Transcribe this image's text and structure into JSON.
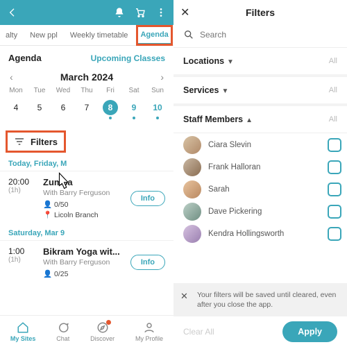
{
  "left": {
    "tabs": {
      "t0": "alty",
      "t1": "New ppl",
      "t2": "Weekly timetable",
      "t3": "Agenda"
    },
    "section": {
      "title": "Agenda",
      "upcoming": "Upcoming Classes"
    },
    "month": "March 2024",
    "dow": {
      "d0": "Mon",
      "d1": "Tue",
      "d2": "Wed",
      "d3": "Thu",
      "d4": "Fri",
      "d5": "Sat",
      "d6": "Sun"
    },
    "dates": {
      "n0": "4",
      "n1": "5",
      "n2": "6",
      "n3": "7",
      "n4": "8",
      "n5": "9",
      "n6": "10"
    },
    "filters_label": "Filters",
    "today_label": "Today, Friday, M",
    "sat_label": "Saturday, Mar 9",
    "class1": {
      "time": "20:00",
      "dur": "(1h)",
      "name": "Zumba",
      "with": "With Barry Ferguson",
      "cap": "0/50",
      "loc": "Licoln Branch",
      "info": "Info"
    },
    "class2": {
      "time": "1:00",
      "dur": "(1h)",
      "name": "Bikram Yoga wit...",
      "with": "With Barry Ferguson",
      "cap": "0/25",
      "info": "Info"
    },
    "nav": {
      "a": "My Sites",
      "b": "Chat",
      "c": "Discover",
      "d": "My Profile"
    }
  },
  "right": {
    "title": "Filters",
    "search_ph": "Search",
    "loc": "Locations",
    "svc": "Services",
    "staff": "Staff Members",
    "all": "All",
    "s0": "Ciara Slevin",
    "s1": "Frank Halloran",
    "s2": "Sarah",
    "s3": "Dave Pickering",
    "s4": "Kendra Hollingsworth",
    "toast": "Your filters will be saved until cleared, even after you close the app.",
    "clear": "Clear All",
    "apply": "Apply"
  }
}
